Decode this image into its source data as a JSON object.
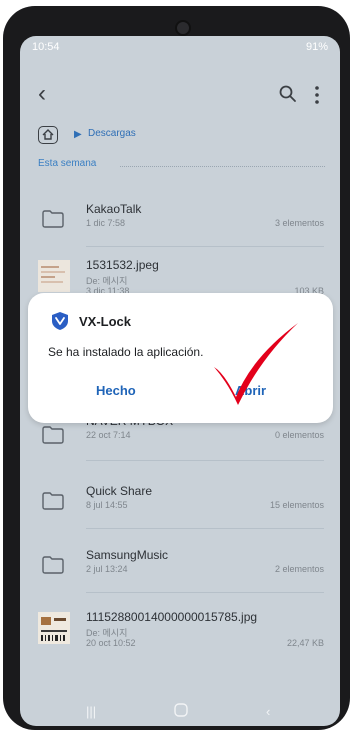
{
  "status": {
    "time": "10:54",
    "right": "91%"
  },
  "breadcrumb": {
    "label": "Descargas"
  },
  "section": {
    "title": "Esta semana"
  },
  "files": [
    {
      "name": "KakaoTalk",
      "date": "1 dic 7:58",
      "meta": "3 elementos",
      "icon": "folder-icon"
    },
    {
      "name": "1531532.jpeg",
      "sub": "De: 메시지",
      "date": "3 dic 11:38",
      "meta": "103 KB",
      "icon": "image-thumbnail"
    },
    {
      "name": "NAVER MYBOX",
      "date": "22 oct 7:14",
      "meta": "0 elementos",
      "icon": "folder-icon"
    },
    {
      "name": "Quick Share",
      "date": "8 jul 14:55",
      "meta": "15 elementos",
      "icon": "folder-icon"
    },
    {
      "name": "SamsungMusic",
      "date": "2 jul 13:24",
      "meta": "2 elementos",
      "icon": "folder-icon"
    },
    {
      "name": "11152880014000000015785.jpg",
      "sub": "De: 메시지",
      "date": "20 oct 10:52",
      "meta": "22,47 KB",
      "icon": "image-thumbnail"
    }
  ],
  "dialog": {
    "app_name": "VX-Lock",
    "message": "Se ha instalado la aplicación.",
    "left_button": "Hecho",
    "right_button": "Abrir"
  },
  "colors": {
    "accent": "#1f64b8",
    "check": "#e3001b"
  }
}
